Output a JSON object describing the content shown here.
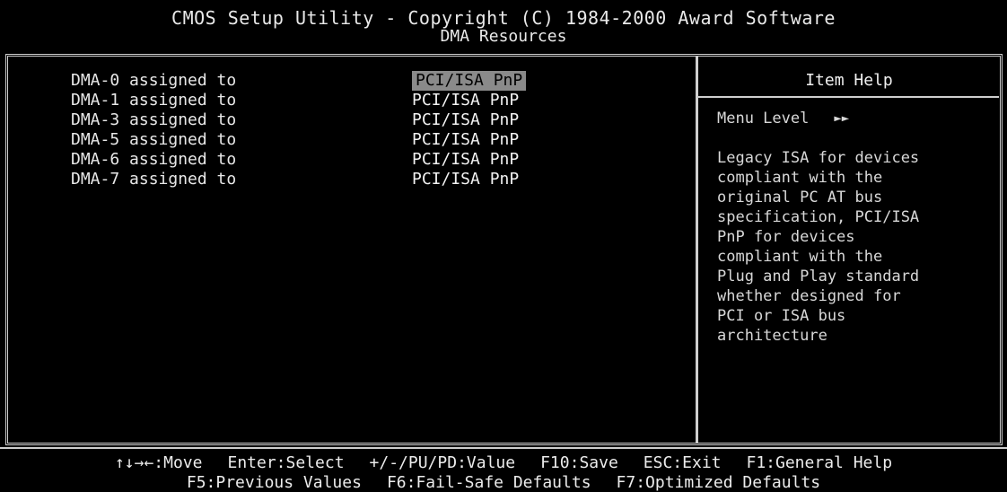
{
  "app": {
    "title": "CMOS Setup Utility - Copyright (C) 1984-2000 Award Software",
    "subtitle": "DMA Resources"
  },
  "settings": [
    {
      "label": "DMA-0 assigned to",
      "value": "PCI/ISA PnP"
    },
    {
      "label": "DMA-1 assigned to",
      "value": "PCI/ISA PnP"
    },
    {
      "label": "DMA-3 assigned to",
      "value": "PCI/ISA PnP"
    },
    {
      "label": "DMA-5 assigned to",
      "value": "PCI/ISA PnP"
    },
    {
      "label": "DMA-6 assigned to",
      "value": "PCI/ISA PnP"
    },
    {
      "label": "DMA-7 assigned to",
      "value": "PCI/ISA PnP"
    }
  ],
  "help": {
    "title": "Item Help",
    "menu_level_label": "Menu Level",
    "menu_level_arrow": "►►",
    "text": "Legacy ISA for devices\ncompliant with the\noriginal PC AT bus\nspecification, PCI/ISA\nPnP for devices\ncompliant with the\nPlug and Play standard\nwhether designed for\nPCI or ISA bus\narchitecture"
  },
  "footer": {
    "row1": [
      "↑↓→←:Move",
      "Enter:Select",
      "+/-/PU/PD:Value",
      "F10:Save",
      "ESC:Exit",
      "F1:General Help"
    ],
    "row2": [
      "F5:Previous Values",
      "F6:Fail-Safe Defaults",
      "F7:Optimized Defaults"
    ]
  },
  "colors": {
    "background": "#000000",
    "text": "#e6e6e6",
    "highlight": "#8a8a8a"
  }
}
